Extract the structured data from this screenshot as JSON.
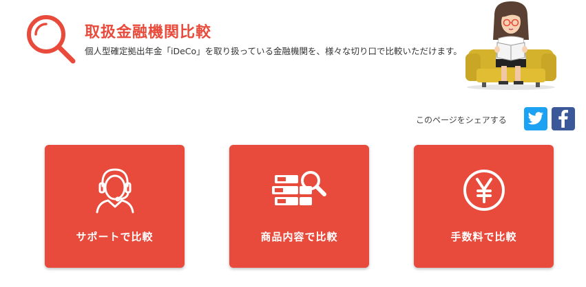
{
  "header": {
    "title": "取扱金融機関比較",
    "description": "個人型確定拠出年金「iDeCo」を取り扱っている金融機関を、様々な切り口で比較いただけます。"
  },
  "share": {
    "label": "このページをシェアする",
    "icons": [
      "twitter-icon",
      "facebook-icon"
    ]
  },
  "cards": [
    {
      "label": "サポートで比較",
      "icon": "operator-headset-icon"
    },
    {
      "label": "商品内容で比較",
      "icon": "documents-search-icon"
    },
    {
      "label": "手数料で比較",
      "icon": "yen-coin-icon"
    }
  ],
  "colors": {
    "accent": "#e84b3c",
    "twitter": "#1da1f2",
    "facebook": "#3b5998"
  }
}
